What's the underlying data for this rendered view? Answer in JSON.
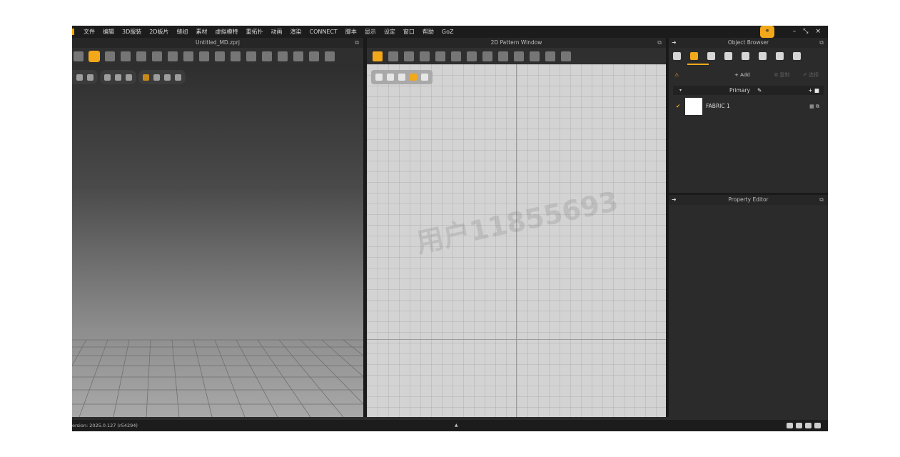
{
  "menubar": {
    "items": [
      "文件",
      "编辑",
      "3D服装",
      "2D板片",
      "缝纫",
      "素材",
      "虚拟模特",
      "重拓扑",
      "动画",
      "渲染",
      "CONNECT",
      "脚本",
      "显示",
      "设定",
      "窗口",
      "帮助",
      "GoZ"
    ],
    "badge_icon": "connect-icon",
    "window_controls": [
      "–",
      "⤡",
      "×"
    ]
  },
  "panels": {
    "viewport3d_title": "Untitled_MD.zprj",
    "pattern2d_title": "2D Pattern Window",
    "object_browser_title": "Object Browser",
    "property_editor_title": "Property Editor",
    "float_glyph": "⧉",
    "pin_glyph": "➜"
  },
  "pattern2d": {
    "watermark": "用户11855693"
  },
  "object_browser": {
    "add_label": "+ Add",
    "dim_action_1": "⧉ 复制",
    "dim_action_2": "✐ 选择",
    "group_name": "Primary",
    "group_caret": "▾",
    "group_edit_glyph": "✎",
    "group_add_glyph": "+ ■",
    "fabric": {
      "check": "✔",
      "name": "FABRIC 1",
      "swatch_color": "#ffffff",
      "icons": "▦ ⧉"
    },
    "lock_glyph": "⚠"
  },
  "statusbar": {
    "version": "ersion: 2025.0.127 (r54294)",
    "mid_glyph": "▲"
  },
  "colors": {
    "accent": "#f3a81a",
    "app_bg": "#2b2b2b",
    "pattern_bg": "#d3d3d3"
  }
}
